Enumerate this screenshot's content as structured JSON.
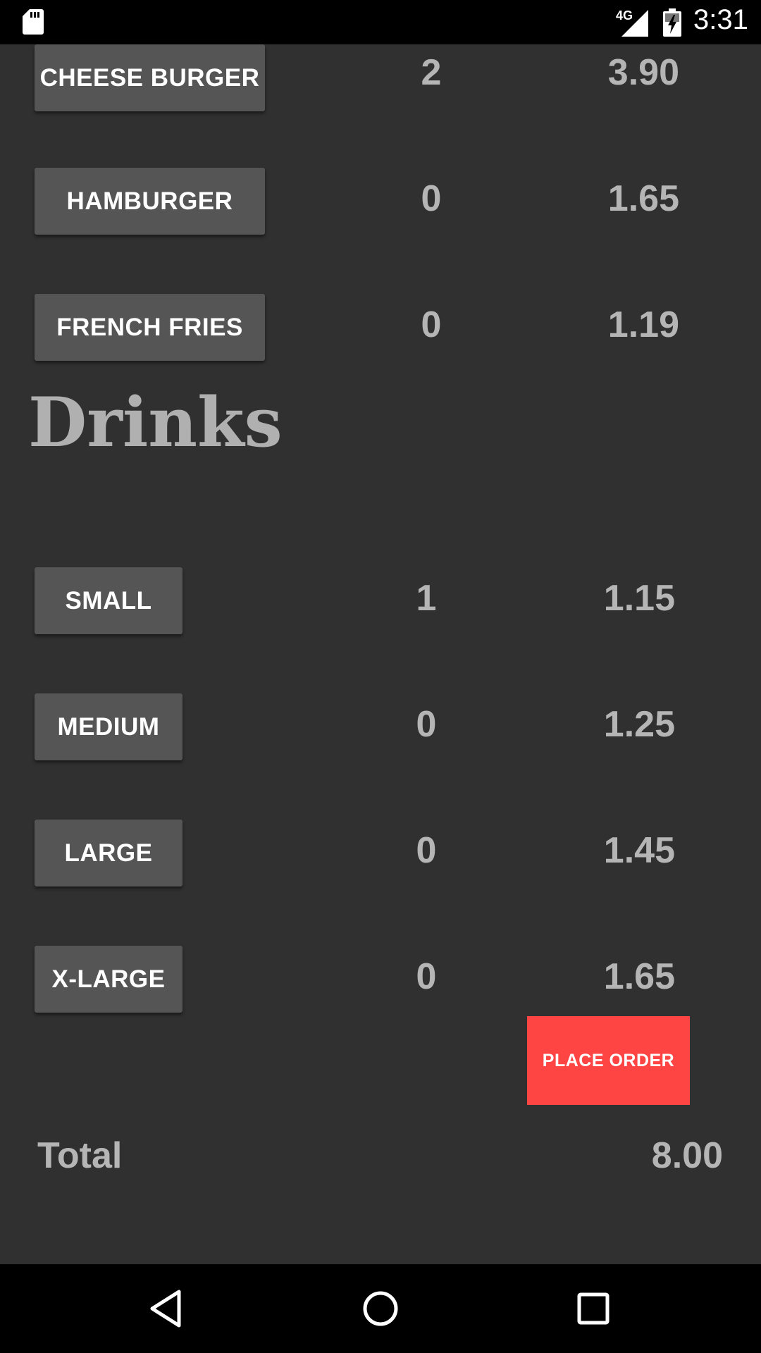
{
  "status_bar": {
    "network": "4G",
    "time": "3:31",
    "icons": [
      "sd-card-icon",
      "signal-icon",
      "battery-charging-icon"
    ]
  },
  "food_items": [
    {
      "label": "CHEESE BURGER",
      "qty": "2",
      "price": "3.90"
    },
    {
      "label": "HAMBURGER",
      "qty": "0",
      "price": "1.65"
    },
    {
      "label": "FRENCH FRIES",
      "qty": "0",
      "price": "1.19"
    }
  ],
  "drinks": {
    "title": "Drinks",
    "items": [
      {
        "label": "SMALL",
        "qty": "1",
        "price": "1.15"
      },
      {
        "label": "MEDIUM",
        "qty": "0",
        "price": "1.25"
      },
      {
        "label": "LARGE",
        "qty": "0",
        "price": "1.45"
      },
      {
        "label": "X-LARGE",
        "qty": "0",
        "price": "1.65"
      }
    ]
  },
  "place_order_label": "PLACE ORDER",
  "total": {
    "label": "Total",
    "value": "8.00"
  },
  "nav_bar": {
    "icons": [
      "back-icon",
      "home-icon",
      "recents-icon"
    ]
  },
  "colors": {
    "background": "#303030",
    "button": "#555556",
    "accent": "#ff4444",
    "value_text": "#b5b5b5"
  }
}
